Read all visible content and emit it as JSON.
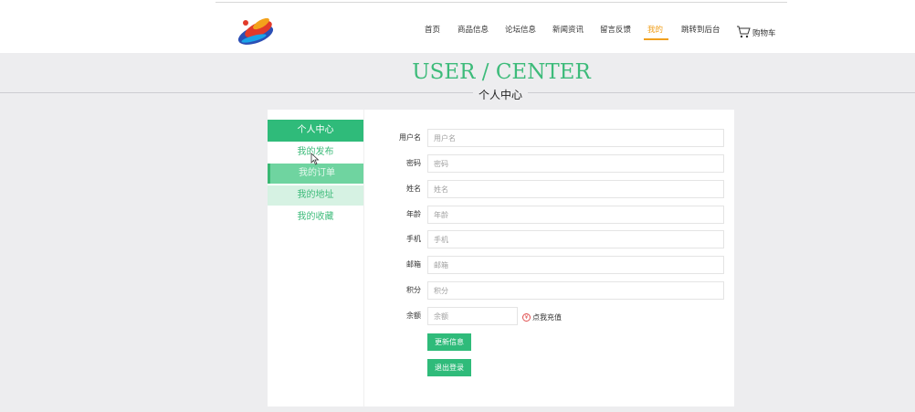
{
  "header": {
    "nav": [
      {
        "label": "首页",
        "active": false
      },
      {
        "label": "商品信息",
        "active": false
      },
      {
        "label": "论坛信息",
        "active": false
      },
      {
        "label": "新闻资讯",
        "active": false
      },
      {
        "label": "留言反馈",
        "active": false
      },
      {
        "label": "我的",
        "active": true
      },
      {
        "label": "跳转到后台",
        "active": false
      }
    ],
    "cart_label": "购物车",
    "accent": "#f0a01e"
  },
  "page": {
    "title_en": "USER / CENTER",
    "title_cn": "个人中心"
  },
  "sidebar": {
    "heading": "个人中心",
    "items": [
      {
        "label": "我的发布",
        "state": "normal"
      },
      {
        "label": "我的订单",
        "state": "selected"
      },
      {
        "label": "我的地址",
        "state": "hover"
      },
      {
        "label": "我的收藏",
        "state": "normal"
      }
    ]
  },
  "form": {
    "fields": [
      {
        "label": "用户名",
        "placeholder": "用户名"
      },
      {
        "label": "密码",
        "placeholder": "密码"
      },
      {
        "label": "姓名",
        "placeholder": "姓名"
      },
      {
        "label": "年龄",
        "placeholder": "年龄"
      },
      {
        "label": "手机",
        "placeholder": "手机"
      },
      {
        "label": "邮箱",
        "placeholder": "邮箱"
      },
      {
        "label": "积分",
        "placeholder": "积分"
      },
      {
        "label": "余额",
        "placeholder": "余额"
      }
    ],
    "recharge_label": "点我充值",
    "update_button": "更新信息",
    "logout_button": "退出登录"
  },
  "colors": {
    "brand_green": "#2fbb7a",
    "background_grey": "#ededef"
  }
}
